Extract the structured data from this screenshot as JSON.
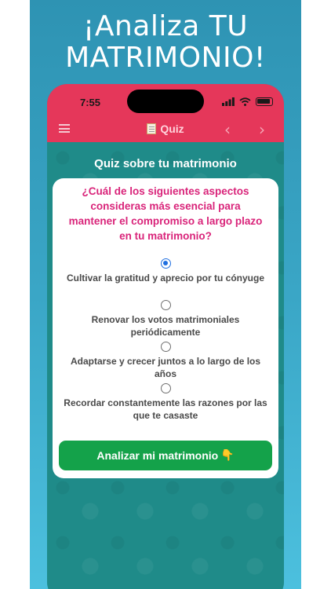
{
  "headline": {
    "line1": "¡Analiza TU",
    "line2": "MATRIMONIO!"
  },
  "status_bar": {
    "time": "7:55"
  },
  "app_bar": {
    "title": "Quiz",
    "icons": [
      "menu-icon",
      "memo-icon",
      "chevron-left-icon",
      "chevron-right-icon"
    ]
  },
  "quiz": {
    "section_title": "Quiz sobre tu matrimonio",
    "question": "¿Cuál de los siguientes aspectos consideras más esencial para mantener el compromiso a largo plazo en tu matrimonio?",
    "options": [
      {
        "label": "Cultivar la gratitud y aprecio por tu cónyuge",
        "selected": true
      },
      {
        "label": "Renovar los votos matrimoniales periódicamente",
        "selected": false
      },
      {
        "label": "Adaptarse y crecer juntos a lo largo de los años",
        "selected": false
      },
      {
        "label": "Recordar constantemente las razones por las que te casaste",
        "selected": false
      }
    ],
    "button_label": "Analizar mi matrimonio"
  },
  "colors": {
    "app_bar": "#e5375a",
    "background": "#1f8b89",
    "question": "#d9247a",
    "button": "#14a24a",
    "radio_selected": "#1f6fe0"
  }
}
